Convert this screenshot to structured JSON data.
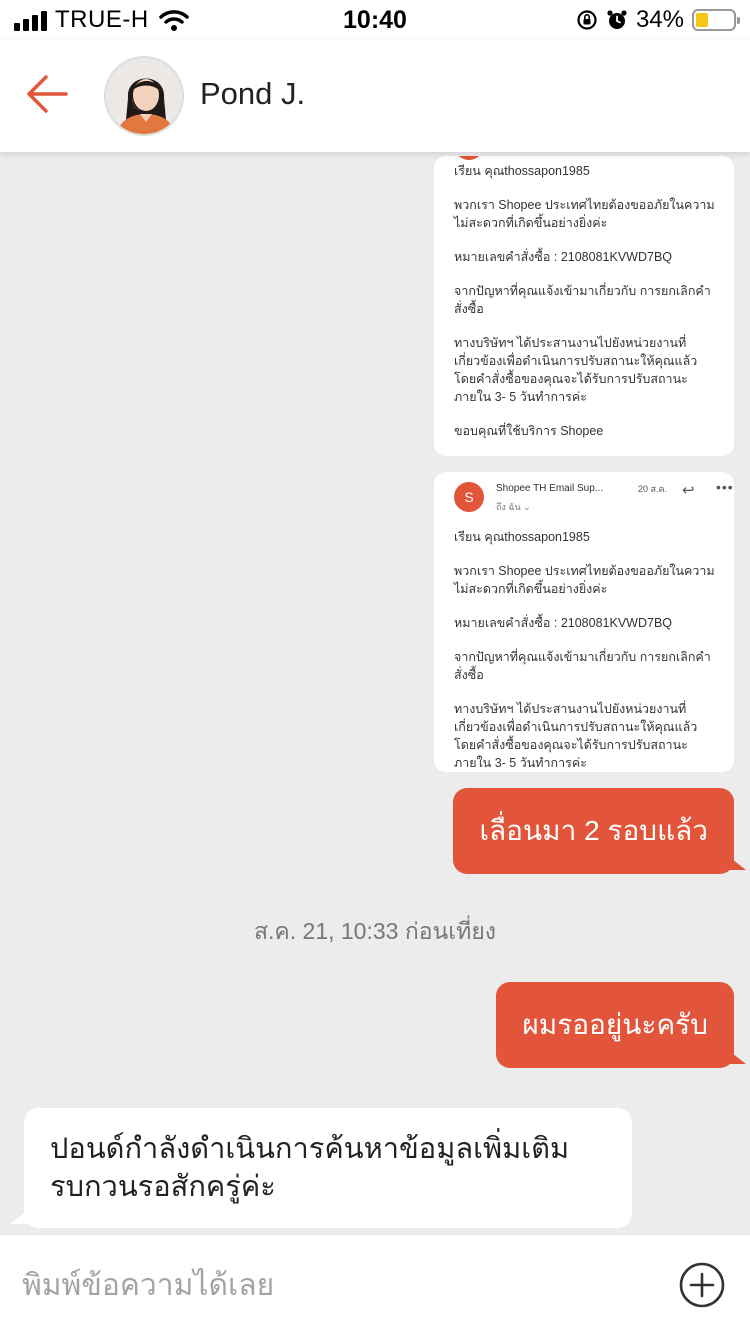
{
  "status_bar": {
    "carrier": "TRUE-H",
    "time": "10:40",
    "battery": "34%",
    "battery_level": 0.34
  },
  "header": {
    "contact_name": "Pond J."
  },
  "chat": {
    "email_1": {
      "greeting": "เรียน คุณthossapon1985",
      "apology": "พวกเรา Shopee ประเทศไทยต้องขออภัยในความไม่สะดวกที่เกิดขึ้นอย่างยิ่งค่ะ",
      "order": "หมายเลขคำสั่งซื้อ : 2108081KVWD7BQ",
      "issue": "จากปัญหาที่คุณแจ้งเข้ามาเกี่ยวกับ การยกเลิกคำสั่งซื้อ",
      "action": "ทางบริษัทฯ ได้ประสานงานไปยังหน่วยงานที่เกี่ยวข้องเพื่อดำเนินการปรับสถานะให้คุณแล้ว โดยคำสั่งซื้อของคุณจะได้รับการปรับสถานะภายใน 3- 5 วันทำการค่ะ",
      "closing": "ขอบคุณที่ใช้บริการ Shopee"
    },
    "email_2": {
      "avatar_letter": "S",
      "sender": "Shopee TH Email Sup...",
      "date": "20 ส.ค.",
      "to": "ถึง ฉัน ⌄",
      "greeting": "เรียน คุณthossapon1985",
      "apology": "พวกเรา Shopee ประเทศไทยต้องขออภัยในความไม่สะดวกที่เกิดขึ้นอย่างยิ่งค่ะ",
      "order": "หมายเลขคำสั่งซื้อ : 2108081KVWD7BQ",
      "issue": "จากปัญหาที่คุณแจ้งเข้ามาเกี่ยวกับ การยกเลิกคำสั่งซื้อ",
      "action": "ทางบริษัทฯ ได้ประสานงานไปยังหน่วยงานที่เกี่ยวข้องเพื่อดำเนินการปรับสถานะให้คุณแล้ว โดยคำสั่งซื้อของคุณจะได้รับการปรับสถานะภายใน 3- 5 วันทำการค่ะ"
    },
    "sent_1": "เลื่อนมา 2 รอบแล้ว",
    "timestamp": "ส.ค. 21, 10:33 ก่อนเที่ยง",
    "sent_2": "ผมรออยู่นะครับ",
    "received_1": "ปอนด์กำลังดำเนินการค้นหาข้อมูลเพิ่มเติม รบกวนรอสักครู่ค่ะ"
  },
  "input": {
    "placeholder": "พิมพ์ข้อความได้เลย"
  },
  "colors": {
    "accent": "#e2553a",
    "background": "#ececec"
  },
  "icons": [
    "signal-icon",
    "wifi-icon",
    "orientation-lock-icon",
    "alarm-icon",
    "battery-icon",
    "back-arrow-icon",
    "plus-circle-icon"
  ]
}
